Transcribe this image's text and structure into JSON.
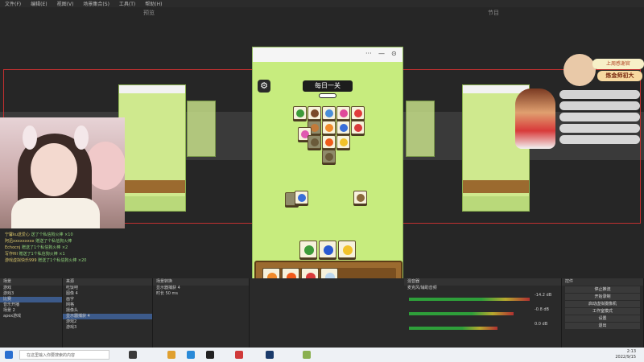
{
  "menubar": {
    "items": [
      "文件(F)",
      "编辑(E)",
      "视图(V)",
      "场景集合(S)",
      "工具(T)",
      "帮助(H)"
    ]
  },
  "studio": {
    "preview_label": "预览",
    "program_label": "节目"
  },
  "chat": {
    "lines": [
      {
        "name": "宁馨ku送爱心",
        "text": "送了个私信狗火棒 ×10"
      },
      {
        "name": "阿迅xxxxxxxxx",
        "text": "赠送了个私信狗火棒"
      },
      {
        "name": "Echocnj",
        "text": "赠送了1个私信狗火棒 ×2"
      },
      {
        "name": "写作fill",
        "text": "赠送了1个私信狗火棒 ×1"
      },
      {
        "name": "游戏虚拟快乐999",
        "text": "赠送了1个私信狗火棒 ×20"
      }
    ]
  },
  "overlay": {
    "anchor_title": "上周感谢官",
    "anchor_name": "炼金师初大"
  },
  "game": {
    "level_title": "每日一关",
    "titlebar_controls": [
      "···",
      "—",
      "⊙"
    ],
    "settings_icon": "gear-icon"
  },
  "docks": {
    "scenes_title": "场景",
    "scenes": [
      "游戏",
      "游戏3",
      "比赛",
      "音乐开播",
      "场景 2",
      "apex游戏"
    ],
    "sources_title": "来源",
    "sources": [
      "吃饭吧",
      "图像 4",
      "画字",
      "网格",
      "摄像头",
      "显示器捕获 4",
      "游戏2",
      "游戏3"
    ],
    "mixer_title": "混音器",
    "properties_label": "属性",
    "filters_label": "滤镜",
    "display_label": "显示器捕获 4",
    "preview_label": "显示器: 1920x1080 @ 0,0",
    "transitions_title": "场景转换",
    "duration_label": "时长",
    "duration_value": "50 ms",
    "controls_title": "控件",
    "controls": [
      "停止推流",
      "开始录制",
      "启动虚拟摄像机",
      "工作室模式",
      "设置",
      "退出"
    ],
    "desktop_audio_label": "麦克风/辅助音频",
    "db_values": [
      "-14.2 dB",
      "-0.8 dB",
      "0.0 dB"
    ]
  },
  "taskbar": {
    "search_placeholder": "在这里输入你要搜索的内容",
    "time": "2:13",
    "date": "2022/9/15"
  }
}
